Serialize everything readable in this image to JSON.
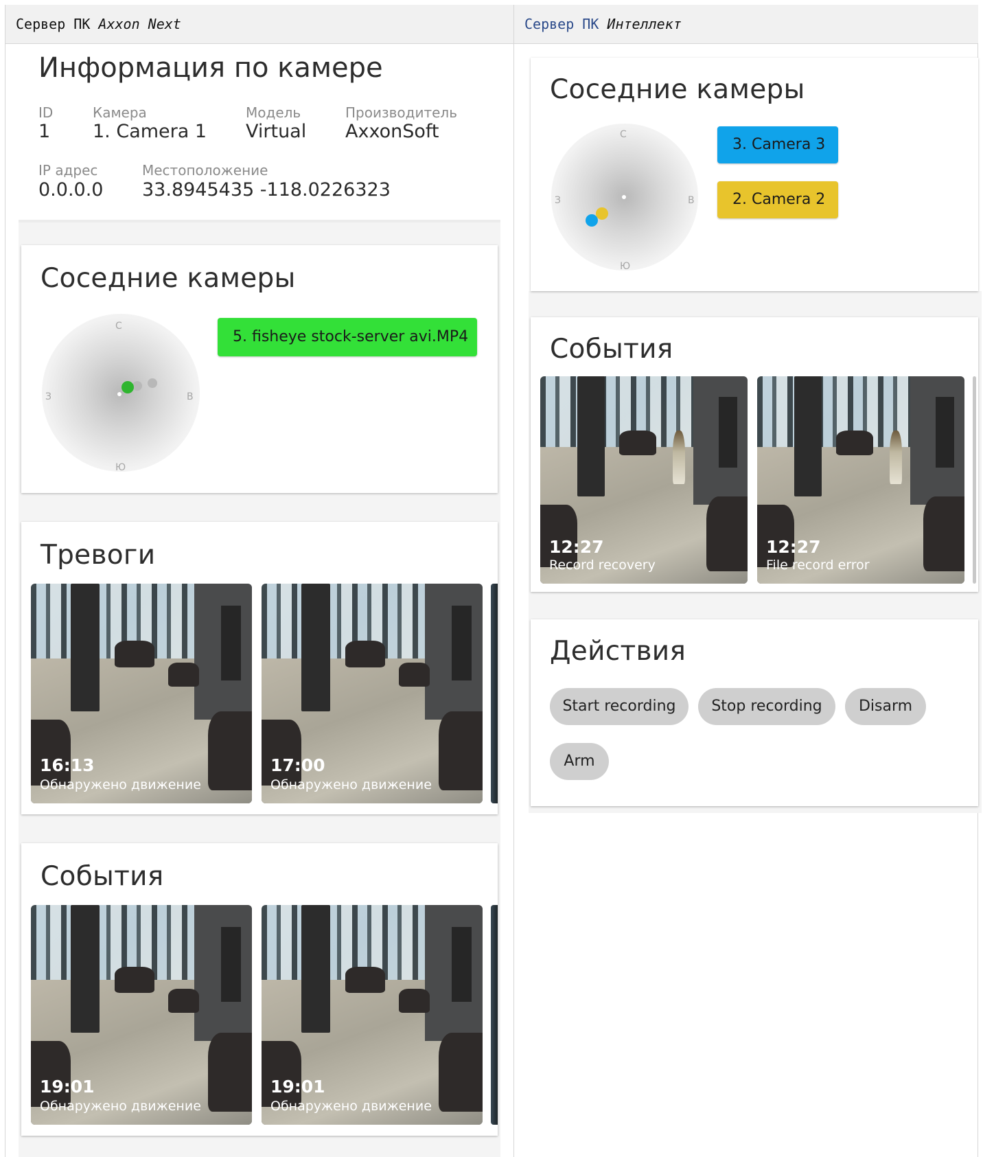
{
  "left_column": {
    "header": {
      "prefix": "Сервер ПК",
      "product": "Axxon Next"
    },
    "info": {
      "title": "Информация по камере",
      "fields": [
        {
          "label": "ID",
          "value": "1"
        },
        {
          "label": "Камера",
          "value": "1. Camera 1"
        },
        {
          "label": "Модель",
          "value": "Virtual"
        },
        {
          "label": "Производитель",
          "value": "AxxonSoft"
        },
        {
          "label": "IP адрес",
          "value": "0.0.0.0"
        },
        {
          "label": "Местоположение",
          "value": "33.8945435 -118.0226323"
        }
      ]
    },
    "neighbors": {
      "title": "Соседние камеры",
      "compass": {
        "n": "С",
        "s": "Ю",
        "w": "З",
        "e": "В"
      },
      "cameras": [
        {
          "label": "5. fisheye stock-server avi.MP4",
          "color": "#33e038"
        }
      ],
      "dot_colors": [
        "#2fb52f",
        "#b8b8b8",
        "#b8b8b8",
        "#ffffff"
      ]
    },
    "alarms": {
      "title": "Тревоги",
      "items": [
        {
          "time": "16:13",
          "caption": "Обнаружено движение"
        },
        {
          "time": "17:00",
          "caption": "Обнаружено движение"
        }
      ]
    },
    "events": {
      "title": "События",
      "items": [
        {
          "time": "19:01",
          "caption": "Обнаружено движение"
        },
        {
          "time": "19:01",
          "caption": "Обнаружено движение"
        }
      ]
    }
  },
  "right_column": {
    "header": {
      "prefix": "Сервер ПК",
      "product": "Интеллект"
    },
    "neighbors": {
      "title": "Соседние камеры",
      "compass": {
        "n": "С",
        "s": "Ю",
        "w": "З",
        "e": "В"
      },
      "cameras": [
        {
          "label": "3. Camera 3",
          "color": "#10a3ea"
        },
        {
          "label": "2. Camera 2",
          "color": "#e8c42c"
        }
      ]
    },
    "events": {
      "title": "События",
      "items": [
        {
          "time": "12:27",
          "caption": "Record recovery"
        },
        {
          "time": "12:27",
          "caption": "File record error"
        }
      ]
    },
    "actions": {
      "title": "Действия",
      "buttons": [
        "Start recording",
        "Stop recording",
        "Disarm",
        "Arm"
      ]
    }
  }
}
